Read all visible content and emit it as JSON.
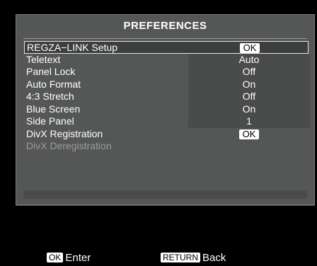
{
  "panel": {
    "title": "PREFERENCES"
  },
  "menu": [
    {
      "label": "REGZA−LINK Setup",
      "value": "OK",
      "value_type": "button",
      "selected": true,
      "enabled": true
    },
    {
      "label": "Teletext",
      "value": "Auto",
      "value_type": "text",
      "selected": false,
      "enabled": true
    },
    {
      "label": "Panel Lock",
      "value": "Off",
      "value_type": "text",
      "selected": false,
      "enabled": true
    },
    {
      "label": "Auto Format",
      "value": "On",
      "value_type": "text",
      "selected": false,
      "enabled": true
    },
    {
      "label": "4:3 Stretch",
      "value": "Off",
      "value_type": "text",
      "selected": false,
      "enabled": true
    },
    {
      "label": "Blue Screen",
      "value": "On",
      "value_type": "text",
      "selected": false,
      "enabled": true
    },
    {
      "label": "Side Panel",
      "value": "1",
      "value_type": "text",
      "selected": false,
      "enabled": true
    },
    {
      "label": "DivX Registration",
      "value": "OK",
      "value_type": "button",
      "selected": false,
      "enabled": true
    },
    {
      "label": "DivX Deregistration",
      "value": "",
      "value_type": "none",
      "selected": false,
      "enabled": false
    }
  ],
  "legend": {
    "enter_key": "OK",
    "enter_label": "Enter",
    "back_key": "RETURN",
    "back_label": "Back"
  },
  "colors": {
    "panel_bg": "#555656",
    "value_cell_bg": "#4a4b4b",
    "selected_border": "#e6e6e6",
    "disabled_text": "#9b9b9b"
  }
}
